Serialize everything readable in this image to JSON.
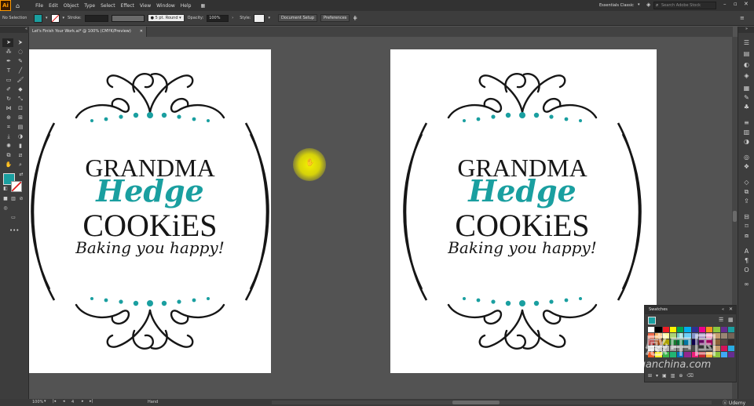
{
  "app": {
    "logo": "Ai",
    "workspace": "Essentials Classic",
    "search_placeholder": "Search Adobe Stock"
  },
  "menu": [
    "File",
    "Edit",
    "Object",
    "Type",
    "Select",
    "Effect",
    "View",
    "Window",
    "Help"
  ],
  "control": {
    "selection": "No Selection",
    "stroke_label": "Stroke:",
    "brush": "5 pt. Round",
    "opacity_label": "Opacity:",
    "opacity_value": "100%",
    "style_label": "Style:",
    "doc_setup": "Document Setup",
    "preferences": "Preferences"
  },
  "doc_tab": {
    "title": "Let's Finish Your Work.ai* @ 100% (CMYK/Preview)"
  },
  "logo_text": {
    "line1": "GRANDMA",
    "line2": "Hedge",
    "line3": "COOKiES",
    "tagline": "Baking you happy!"
  },
  "swatches_panel": {
    "title": "Swatches"
  },
  "status": {
    "zoom": "100%",
    "artboard": "4",
    "tool": "Hand"
  },
  "watermark": {
    "brand": "灵感中国",
    "url": "lingganchina.com"
  },
  "udemy": "Udemy",
  "colors": {
    "teal": "#1a9fa0",
    "ink": "#161616",
    "panel": "#3d3d3d",
    "canvas": "#535353"
  }
}
